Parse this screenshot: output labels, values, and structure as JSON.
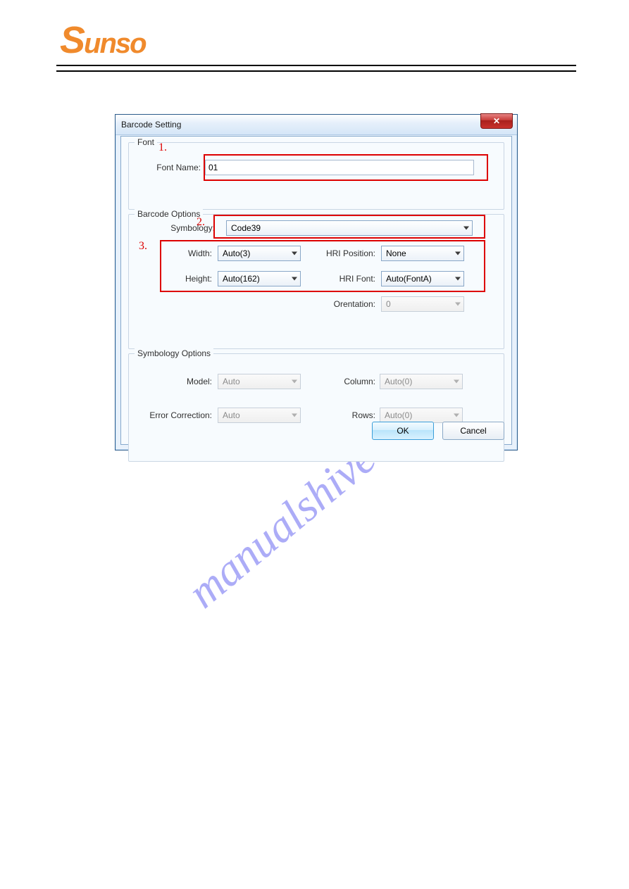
{
  "brand": {
    "logo_rest": "unso"
  },
  "watermark": {
    "text": "manualshive.com"
  },
  "annotations": {
    "a1": "1.",
    "a2": "2.",
    "a3": "3."
  },
  "dialog": {
    "title": "Barcode Setting",
    "font_group": {
      "title": "Font",
      "font_name_label": "Font Name:",
      "font_name_value": "01"
    },
    "barcode_group": {
      "title": "Barcode Options",
      "symbology_label": "Symbology:",
      "symbology_value": "Code39",
      "width_label": "Width:",
      "width_value": "Auto(3)",
      "hri_position_label": "HRI Position:",
      "hri_position_value": "None",
      "height_label": "Height:",
      "height_value": "Auto(162)",
      "hri_font_label": "HRI Font:",
      "hri_font_value": "Auto(FontA)",
      "orientation_label": "Orentation:",
      "orientation_value": "0"
    },
    "symbology_group": {
      "title": "Symbology Options",
      "model_label": "Model:",
      "model_value": "Auto",
      "column_label": "Column:",
      "column_value": "Auto(0)",
      "error_correction_label": "Error Correction:",
      "error_correction_value": "Auto",
      "rows_label": "Rows:",
      "rows_value": "Auto(0)"
    },
    "buttons": {
      "ok": "OK",
      "cancel": "Cancel"
    }
  }
}
